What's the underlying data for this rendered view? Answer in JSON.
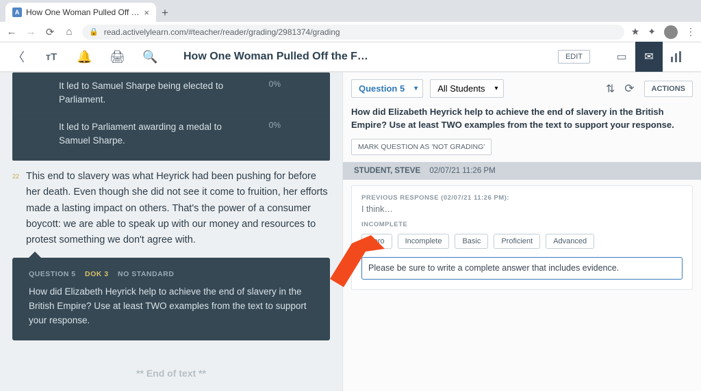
{
  "browser": {
    "tab_title": "How One Woman Pulled Off th…",
    "url": "read.activelylearn.com/#teacher/reader/grading/2981374/grading"
  },
  "appbar": {
    "title": "How One Woman Pulled Off the F…",
    "edit_label": "EDIT"
  },
  "left_quiz": {
    "rows": [
      {
        "text": "It led to Samuel Sharpe being elected to Parliament.",
        "pct": "0%"
      },
      {
        "text": "It led to Parliament awarding a medal to Samuel Sharpe.",
        "pct": "0%"
      }
    ]
  },
  "paragraph": {
    "num": "22",
    "text": "This end to slavery was what Heyrick had been pushing for before her death. Even though she did not see it come to fruition, her efforts made a lasting impact on others. That's the power of a consumer boycott: we are able to speak up with our money and resources to protest something we don't agree with."
  },
  "question_card": {
    "q": "QUESTION 5",
    "dok": "DOK 3",
    "std": "NO STANDARD",
    "text": "How did Elizabeth Heyrick help to achieve the end of slavery in the British Empire? Use at least TWO examples from the text to support your response."
  },
  "end_text": "** End of text **",
  "right": {
    "question_sel": "Question 5",
    "students_sel": "All Students",
    "actions": "ACTIONS",
    "prompt": "How did Elizabeth Heyrick help to achieve the end of slavery in the British Empire? Use at least TWO examples from the text to support your response.",
    "mark_label": "MARK QUESTION AS 'NOT GRADING'",
    "student": {
      "name": "STUDENT, STEVE",
      "ts": "02/07/21 11:26 PM"
    },
    "prev_label": "PREVIOUS RESPONSE (02/07/21 11:26 PM):",
    "prev_text": "I think…",
    "status": "INCOMPLETE",
    "grades": [
      "Zero",
      "Incomplete",
      "Basic",
      "Proficient",
      "Advanced"
    ],
    "feedback": "Please be sure to write a complete answer that includes evidence."
  }
}
